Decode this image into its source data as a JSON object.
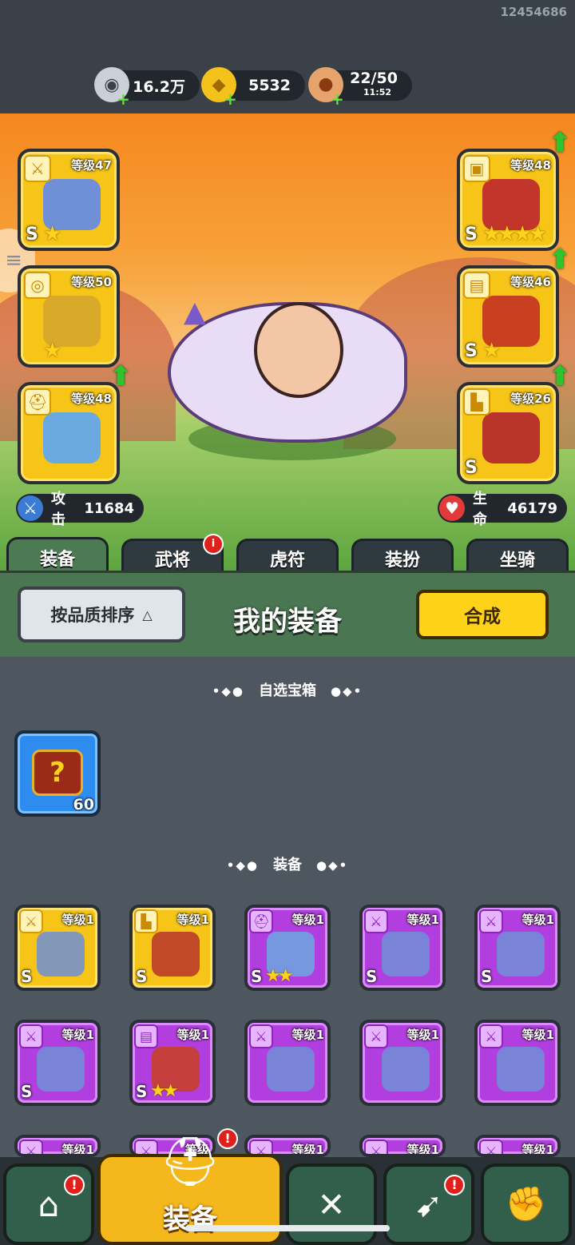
{
  "user_id": "12454686",
  "resources": {
    "silver": {
      "icon": "silver-coin-icon",
      "value": "16.2万"
    },
    "gold": {
      "icon": "gold-ingot-icon",
      "value": "5532"
    },
    "stamina": {
      "icon": "meat-icon",
      "value": "22/50",
      "timer": "11:52"
    }
  },
  "equipped": {
    "left": [
      {
        "slot": "weapon",
        "icon": "sword-icon",
        "level": "等级47",
        "rank": "S",
        "stars": 1
      },
      {
        "slot": "medal",
        "icon": "medal-icon",
        "level": "等级50",
        "rank": "",
        "stars": 1
      },
      {
        "slot": "helmet",
        "icon": "helmet-icon",
        "level": "等级48",
        "rank": "",
        "stars": 0,
        "upgrade": true
      }
    ],
    "right": [
      {
        "slot": "armor",
        "icon": "armor-icon",
        "level": "等级48",
        "rank": "S",
        "stars": 4,
        "upgrade": true
      },
      {
        "slot": "bracer",
        "icon": "bracer-icon",
        "level": "等级46",
        "rank": "S",
        "stars": 1,
        "upgrade": true
      },
      {
        "slot": "boots",
        "icon": "boots-icon",
        "level": "等级26",
        "rank": "S",
        "stars": 0,
        "upgrade": true
      }
    ]
  },
  "stats": {
    "attack_label": "攻击",
    "attack_value": "11684",
    "hp_label": "生命",
    "hp_value": "46179"
  },
  "tabs": [
    "装备",
    "武将",
    "虎符",
    "装扮",
    "坐骑"
  ],
  "toolbar": {
    "sort_label": "按品质排序",
    "title": "我的装备",
    "combine_label": "合成"
  },
  "sections": {
    "chest_header": "自选宝箱",
    "chest_count": "60",
    "equip_header": "装备"
  },
  "items": [
    {
      "rarity": "gold",
      "icon": "sword-icon",
      "level": "等级1",
      "rank": "S",
      "stars": 0
    },
    {
      "rarity": "gold",
      "icon": "boots-icon",
      "level": "等级1",
      "rank": "S",
      "stars": 0
    },
    {
      "rarity": "purple",
      "icon": "helmet-icon",
      "level": "等级1",
      "rank": "S",
      "stars": 2
    },
    {
      "rarity": "purple",
      "icon": "sword-icon",
      "level": "等级1",
      "rank": "S",
      "stars": 0
    },
    {
      "rarity": "purple",
      "icon": "sword-icon",
      "level": "等级1",
      "rank": "S",
      "stars": 0
    },
    {
      "rarity": "purple",
      "icon": "sword-icon",
      "level": "等级1",
      "rank": "S",
      "stars": 0
    },
    {
      "rarity": "purple",
      "icon": "bracer-icon",
      "level": "等级1",
      "rank": "S",
      "stars": 2
    },
    {
      "rarity": "purple",
      "icon": "sword-icon",
      "level": "等级1",
      "rank": "",
      "stars": 0
    },
    {
      "rarity": "purple",
      "icon": "sword-icon",
      "level": "等级1",
      "rank": "",
      "stars": 0
    },
    {
      "rarity": "purple",
      "icon": "sword-icon",
      "level": "等级1",
      "rank": "",
      "stars": 0
    },
    {
      "rarity": "purple",
      "icon": "sword-icon",
      "level": "等级1",
      "rank": "",
      "stars": 0
    },
    {
      "rarity": "purple",
      "icon": "sword-icon",
      "level": "等级",
      "rank": "",
      "stars": 0
    },
    {
      "rarity": "purple",
      "icon": "sword-icon",
      "level": "等级1",
      "rank": "",
      "stars": 0
    },
    {
      "rarity": "purple",
      "icon": "sword-icon",
      "level": "等级1",
      "rank": "",
      "stars": 0
    },
    {
      "rarity": "purple",
      "icon": "sword-icon",
      "level": "等级1",
      "rank": "",
      "stars": 0
    }
  ],
  "bottom_nav": {
    "active_label": "装备",
    "buttons": [
      {
        "icon": "shop-icon",
        "badge": "!"
      },
      {
        "icon": "helmet-icon",
        "badge": "!"
      },
      {
        "icon": "crossed-swords-icon",
        "badge": ""
      },
      {
        "icon": "war-horn-icon",
        "badge": "!"
      },
      {
        "icon": "upgrade-fist-icon",
        "badge": ""
      }
    ]
  },
  "colors": {
    "gold_rarity": "#f7c517",
    "purple_rarity": "#b23ee0",
    "chest_blue": "#2e8cf0",
    "accent_green": "#4c7a52",
    "combine_yellow": "#ffd21a"
  }
}
